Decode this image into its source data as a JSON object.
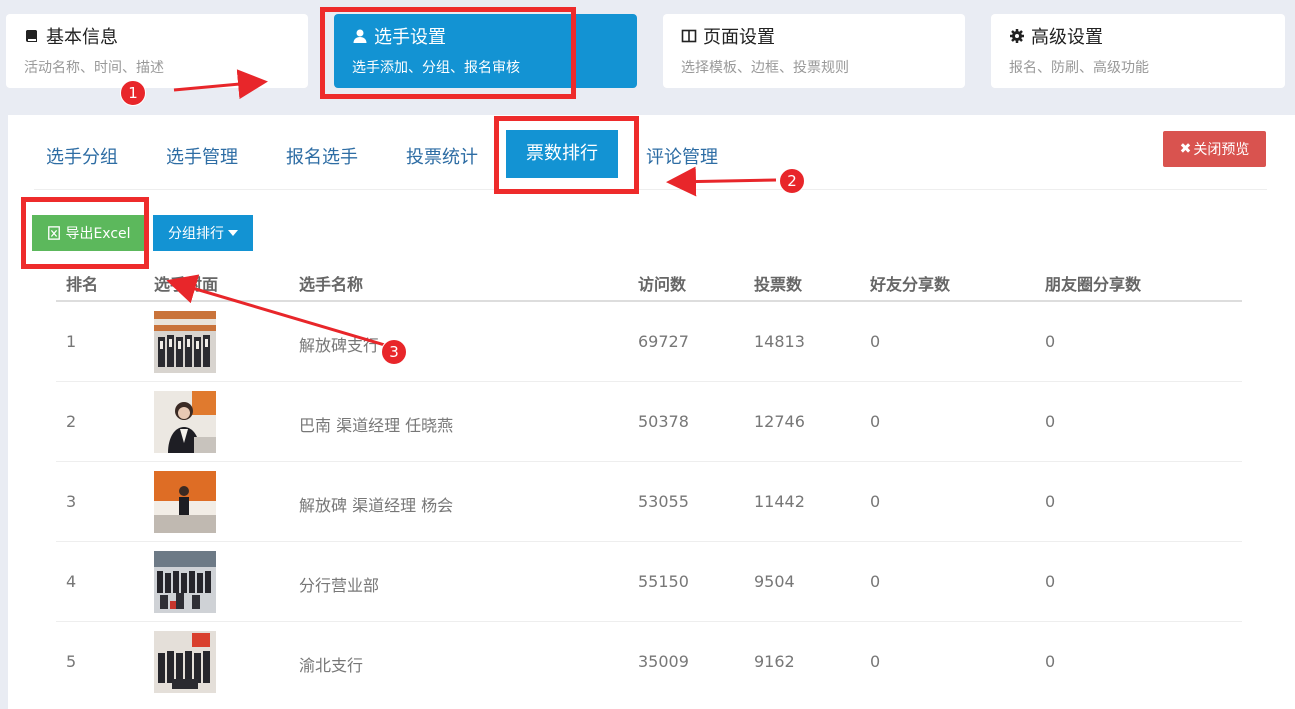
{
  "steps": [
    {
      "title": "基本信息",
      "desc": "活动名称、时间、描述",
      "icon": "book-icon"
    },
    {
      "title": "选手设置",
      "desc": "选手添加、分组、报名审核",
      "icon": "user-icon"
    },
    {
      "title": "页面设置",
      "desc": "选择模板、边框、投票规则",
      "icon": "columns-icon"
    },
    {
      "title": "高级设置",
      "desc": "报名、防刷、高级功能",
      "icon": "gear-icon"
    }
  ],
  "tabs": [
    "选手分组",
    "选手管理",
    "报名选手",
    "投票统计",
    "票数排行",
    "评论管理"
  ],
  "active_tab": "票数排行",
  "close_preview_label": "关闭预览",
  "export_label": "导出Excel",
  "group_rank_label": "分组排行",
  "table": {
    "headers": [
      "排名",
      "选手封面",
      "选手名称",
      "访问数",
      "投票数",
      "好友分享数",
      "朋友圈分享数"
    ],
    "rows": [
      {
        "rank": "1",
        "name": "解放碑支行",
        "visits": "69727",
        "votes": "14813",
        "friend_shares": "0",
        "moment_shares": "0"
      },
      {
        "rank": "2",
        "name": "巴南 渠道经理 任晓燕",
        "visits": "50378",
        "votes": "12746",
        "friend_shares": "0",
        "moment_shares": "0"
      },
      {
        "rank": "3",
        "name": "解放碑 渠道经理 杨会",
        "visits": "53055",
        "votes": "11442",
        "friend_shares": "0",
        "moment_shares": "0"
      },
      {
        "rank": "4",
        "name": "分行营业部",
        "visits": "55150",
        "votes": "9504",
        "friend_shares": "0",
        "moment_shares": "0"
      },
      {
        "rank": "5",
        "name": "渝北支行",
        "visits": "35009",
        "votes": "9162",
        "friend_shares": "0",
        "moment_shares": "0"
      }
    ]
  },
  "annotations": [
    "1",
    "2",
    "3"
  ],
  "colors": {
    "primary": "#1393d3",
    "success": "#5cb85c",
    "danger": "#d9534f",
    "annotation": "#e8262a"
  }
}
